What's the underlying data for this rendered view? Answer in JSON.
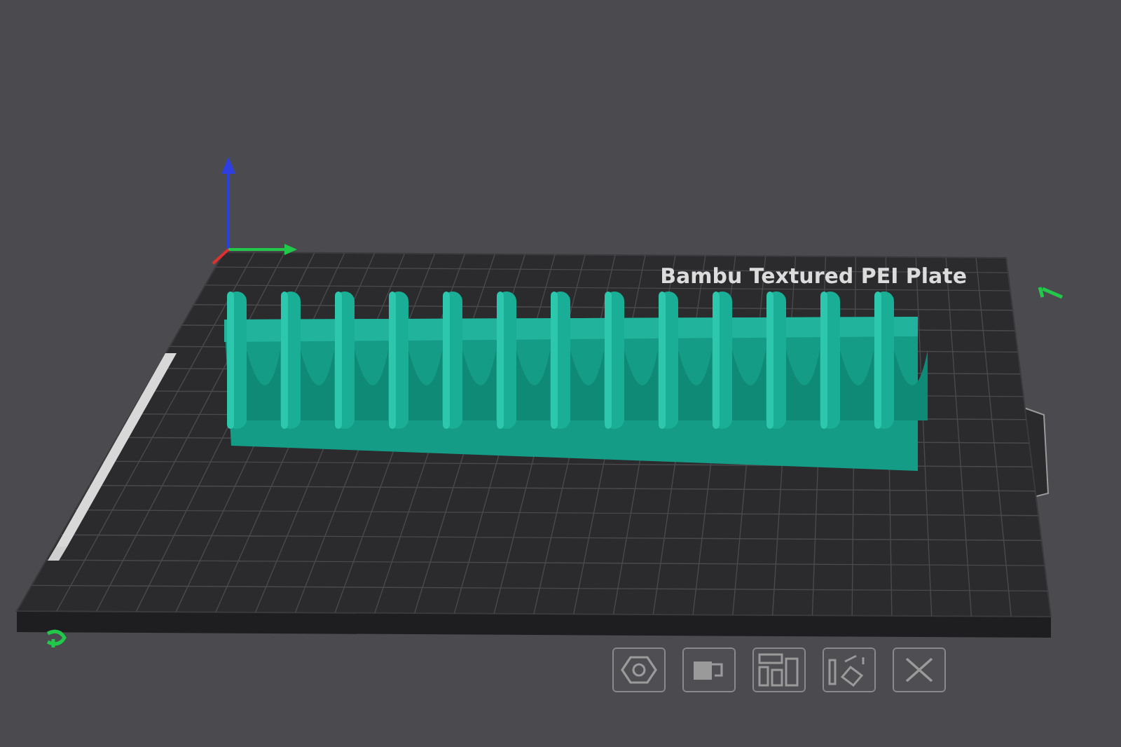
{
  "plate": {
    "label": "Bambu Textured PEI Plate"
  },
  "toolbar": [
    {
      "kind": "hexagon"
    },
    {
      "kind": "cup"
    },
    {
      "kind": "bars"
    },
    {
      "kind": "rotate"
    },
    {
      "kind": "close"
    }
  ]
}
